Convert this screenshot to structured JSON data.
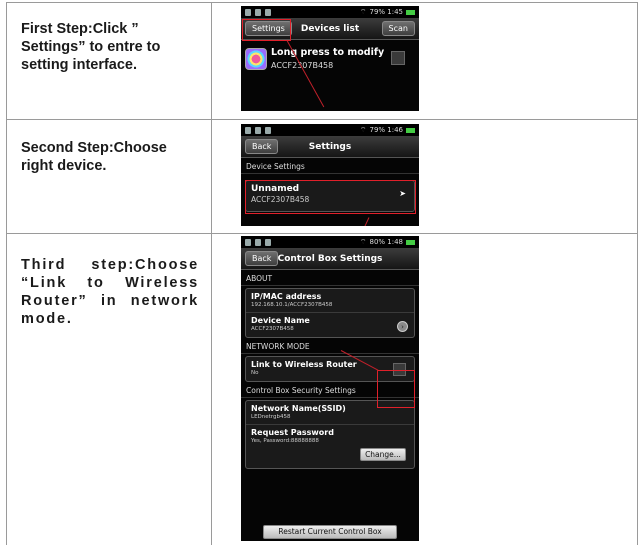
{
  "steps": [
    {
      "text": "First Step:Click ” Settings” to entre to setting interface."
    },
    {
      "text": "Second Step:Choose right device."
    },
    {
      "text": "Third step:Choose “Link to Wireless Router” in network mode."
    }
  ],
  "shot1": {
    "status": "79%  1:45",
    "title": "Devices list",
    "left_button": "Settings",
    "right_button": "Scan",
    "device_name": "Long press to modify",
    "device_id": "ACCF2307B458"
  },
  "shot2": {
    "status": "79%  1:46",
    "title": "Settings",
    "back_button": "Back",
    "section": "Device Settings",
    "device_name": "Unnamed",
    "device_id": "ACCF2307B458"
  },
  "shot3": {
    "status": "80%  1:48",
    "title": "Control Box Settings",
    "back_button": "Back",
    "section_about": "ABOUT",
    "ip_title": "IP/MAC address",
    "ip_value": "192.168.10.1/ACCF2307B458",
    "devname_title": "Device Name",
    "devname_value": "ACCF2307B458",
    "section_network": "NETWORK MODE",
    "router_title": "Link to Wireless Router",
    "router_value": "No",
    "section_security": "Control Box Security Settings",
    "ssid_title": "Network Name(SSID)",
    "ssid_value": "LEDnetrgb458",
    "pwd_title": "Request Password",
    "pwd_value": "Yes, Password:88888888",
    "change_button": "Change...",
    "restart_button": "Restart Current Control Box"
  },
  "colors": {
    "highlight": "#e0202a",
    "phone_bg": "#050505",
    "grid_line": "#9a9a9a"
  }
}
